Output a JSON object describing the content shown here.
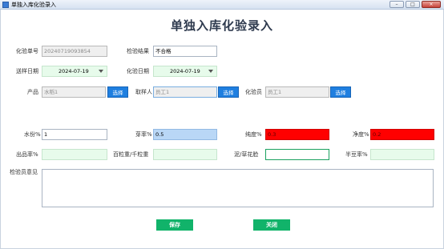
{
  "window": {
    "title": "单独入库化验录入",
    "minimize": "–",
    "maximize": "□",
    "close": "×"
  },
  "heading": "单独入库化验录入",
  "fields": {
    "test_no": {
      "label": "化验单号",
      "value": "20240719093854"
    },
    "result": {
      "label": "检验结果",
      "value": "不合格"
    },
    "send_date": {
      "label": "送样日期",
      "value": "2024-07-19"
    },
    "test_date": {
      "label": "化验日期",
      "value": "2024-07-19"
    },
    "product": {
      "label": "产品",
      "value": "水稻1",
      "button": "选择"
    },
    "sampler": {
      "label": "取样人",
      "value": "员工1",
      "button": "选择"
    },
    "tester": {
      "label": "化验员",
      "value": "员工1",
      "button": "选择"
    },
    "moisture": {
      "label": "水份%",
      "value": "1"
    },
    "bud_rate": {
      "label": "芽率%",
      "value": "0.5"
    },
    "purity": {
      "label": "纯度%",
      "value": "0.3"
    },
    "cleanliness": {
      "label": "净度%",
      "value": "0.2"
    },
    "yield_rate": {
      "label": "出品率%",
      "value": ""
    },
    "grain_weight": {
      "label": "百粒重/千粒重",
      "value": ""
    },
    "mud_ratio": {
      "label": "泥/草花脸",
      "value": ""
    },
    "half_bean": {
      "label": "半豆率%",
      "value": ""
    },
    "opinion": {
      "label": "检验员意见",
      "value": ""
    }
  },
  "actions": {
    "save": "保存",
    "close": "关闭"
  },
  "colors": {
    "accent_green": "#11b36a",
    "pick_blue": "#1f7fe0",
    "alert_red": "#ff0000"
  }
}
